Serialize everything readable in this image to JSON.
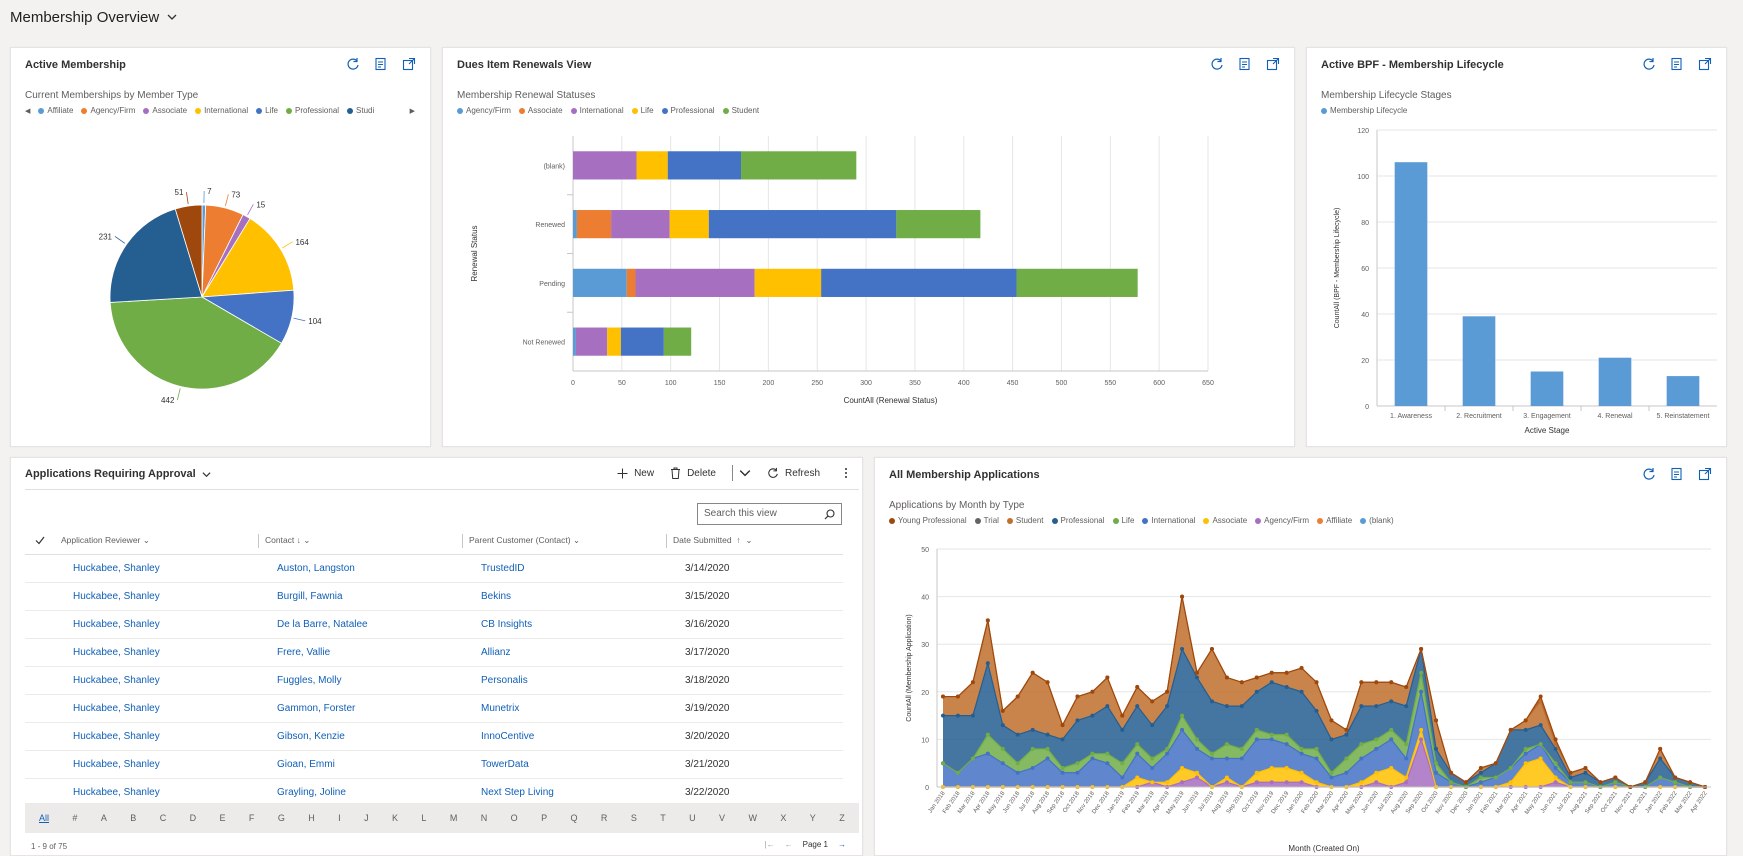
{
  "page": {
    "title": "Membership Overview"
  },
  "card_active_membership": {
    "title": "Active Membership",
    "chart_data": {
      "type": "pie",
      "title": "Current Memberships by Member Type",
      "legend": [
        {
          "name": "Affiliate",
          "color": "#5b9bd5"
        },
        {
          "name": "Agency/Firm",
          "color": "#ed7d31"
        },
        {
          "name": "Associate",
          "color": "#a66fbf"
        },
        {
          "name": "International",
          "color": "#ffc000"
        },
        {
          "name": "Life",
          "color": "#4472c4"
        },
        {
          "name": "Professional",
          "color": "#70ad47"
        },
        {
          "name": "Studi",
          "color": "#255e91"
        }
      ],
      "slices": [
        {
          "value": 7,
          "label": "7",
          "color": "#5b9bd5"
        },
        {
          "value": 73,
          "label": "73",
          "color": "#ed7d31"
        },
        {
          "value": 15,
          "label": "15",
          "color": "#a66fbf"
        },
        {
          "value": 164,
          "label": "164",
          "color": "#ffc000"
        },
        {
          "value": 104,
          "label": "104",
          "color": "#4472c4"
        },
        {
          "value": 442,
          "label": "442",
          "color": "#70ad47"
        },
        {
          "value": 231,
          "label": "231",
          "color": "#255e91"
        },
        {
          "value": 51,
          "label": "51",
          "color": "#9e480e"
        }
      ]
    }
  },
  "card_dues": {
    "title": "Dues Item Renewals View",
    "chart_data": {
      "type": "bar",
      "title": "Membership Renewal Statuses",
      "ylabel": "Renewal Status",
      "xlabel": "CountAll (Renewal Status)",
      "categories": [
        "(blank)",
        "Renewed",
        "Pending",
        "Not Renewed"
      ],
      "xticks": [
        "0",
        "50",
        "100",
        "150",
        "200",
        "250",
        "300",
        "350",
        "400",
        "450",
        "500",
        "550",
        "600",
        "650"
      ],
      "xlim": [
        0,
        650
      ],
      "series": [
        {
          "name": "Agency/Firm",
          "color": "#5b9bd5",
          "values": [
            0,
            4,
            55,
            3
          ]
        },
        {
          "name": "Associate",
          "color": "#ed7d31",
          "values": [
            0,
            35,
            9,
            0
          ]
        },
        {
          "name": "International",
          "color": "#a66fbf",
          "values": [
            65,
            60,
            122,
            32
          ]
        },
        {
          "name": "Life",
          "color": "#ffc000",
          "values": [
            32,
            40,
            68,
            14
          ]
        },
        {
          "name": "Professional",
          "color": "#4472c4",
          "values": [
            75,
            192,
            200,
            44
          ]
        },
        {
          "name": "Student",
          "color": "#70ad47",
          "values": [
            118,
            86,
            124,
            28
          ]
        }
      ]
    }
  },
  "card_bpf": {
    "title": "Active BPF - Membership Lifecycle",
    "chart_data": {
      "type": "bar",
      "title": "Membership Lifecycle Stages",
      "legend": [
        {
          "name": "Membership Lifecycle",
          "color": "#5b9bd5"
        }
      ],
      "categories": [
        "1. Awareness",
        "2. Recruitment",
        "3. Engagement",
        "4. Renewal",
        "5. Reinstatement"
      ],
      "values": [
        106,
        39,
        15,
        21,
        13
      ],
      "ylim": [
        0,
        120
      ],
      "yticks": [
        "0",
        "20",
        "40",
        "60",
        "80",
        "100",
        "120"
      ],
      "xlabel": "Active Stage",
      "ylabel": "CountAll (BPF - Membership Lifecycle)"
    }
  },
  "grid": {
    "title": "Applications Requiring Approval",
    "toolbar": {
      "new": "New",
      "delete": "Delete",
      "refresh": "Refresh"
    },
    "search_placeholder": "Search this view",
    "columns": [
      "Application Reviewer",
      "Contact",
      "Parent Customer (Contact)",
      "Date Submitted"
    ],
    "rows": [
      {
        "reviewer": "Huckabee, Shanley",
        "contact": "Auston, Langston",
        "customer": "TrustedID",
        "date": "3/14/2020"
      },
      {
        "reviewer": "Huckabee, Shanley",
        "contact": "Burgill, Fawnia",
        "customer": "Bekins",
        "date": "3/15/2020"
      },
      {
        "reviewer": "Huckabee, Shanley",
        "contact": "De la Barre, Natalee",
        "customer": "CB Insights",
        "date": "3/16/2020"
      },
      {
        "reviewer": "Huckabee, Shanley",
        "contact": "Frere, Vallie",
        "customer": "Allianz",
        "date": "3/17/2020"
      },
      {
        "reviewer": "Huckabee, Shanley",
        "contact": "Fuggles, Molly",
        "customer": "Personalis",
        "date": "3/18/2020"
      },
      {
        "reviewer": "Huckabee, Shanley",
        "contact": "Gammon, Forster",
        "customer": "Munetrix",
        "date": "3/19/2020"
      },
      {
        "reviewer": "Huckabee, Shanley",
        "contact": "Gibson, Kenzie",
        "customer": "InnoCentive",
        "date": "3/20/2020"
      },
      {
        "reviewer": "Huckabee, Shanley",
        "contact": "Gioan, Emmi",
        "customer": "TowerData",
        "date": "3/21/2020"
      },
      {
        "reviewer": "Huckabee, Shanley",
        "contact": "Grayling, Joline",
        "customer": "Next Step Living",
        "date": "3/22/2020"
      }
    ],
    "alpha": [
      "All",
      "#",
      "A",
      "B",
      "C",
      "D",
      "E",
      "F",
      "G",
      "H",
      "I",
      "J",
      "K",
      "L",
      "M",
      "N",
      "O",
      "P",
      "Q",
      "R",
      "S",
      "T",
      "U",
      "V",
      "W",
      "X",
      "Y",
      "Z"
    ],
    "count_text": "1 - 9 of 75",
    "page_text": "Page 1"
  },
  "card_apps": {
    "title": "All Membership Applications",
    "chart_data": {
      "type": "area",
      "title": "Applications by Month by Type",
      "xlabel": "Month (Created On)",
      "ylabel": "CountAll (Membership Application)",
      "ylim": [
        0,
        50
      ],
      "yticks": [
        "0",
        "10",
        "20",
        "30",
        "40",
        "50"
      ],
      "legend": [
        {
          "name": "Young Professional",
          "color": "#9e480e"
        },
        {
          "name": "Trial",
          "color": "#636363"
        },
        {
          "name": "Student",
          "color": "#c06f2c"
        },
        {
          "name": "Professional",
          "color": "#255e91"
        },
        {
          "name": "Life",
          "color": "#70ad47"
        },
        {
          "name": "International",
          "color": "#4472c4"
        },
        {
          "name": "Associate",
          "color": "#ffc000"
        },
        {
          "name": "Agency/Firm",
          "color": "#a66fbf"
        },
        {
          "name": "Affiliate",
          "color": "#ed7d31"
        },
        {
          "name": "(blank)",
          "color": "#5b9bd5"
        }
      ],
      "x": [
        "Jan 2018",
        "Feb 2018",
        "Mar 2018",
        "Apr 2018",
        "May 2018",
        "Jun 2018",
        "Jul 2018",
        "Aug 2018",
        "Sep 2018",
        "Oct 2018",
        "Nov 2018",
        "Dec 2018",
        "Jan 2019",
        "Feb 2019",
        "Mar 2019",
        "Apr 2019",
        "May 2019",
        "Jun 2019",
        "Jul 2019",
        "Aug 2019",
        "Sep 2019",
        "Oct 2019",
        "Nov 2019",
        "Dec 2019",
        "Jan 2020",
        "Feb 2020",
        "Mar 2020",
        "Apr 2020",
        "May 2020",
        "Jun 2020",
        "Jul 2020",
        "Aug 2020",
        "Sep 2020",
        "Oct 2020",
        "Nov 2020",
        "Dec 2020",
        "Jan 2021",
        "Feb 2021",
        "Mar 2021",
        "Apr 2021",
        "May 2021",
        "Jun 2021",
        "Jul 2021",
        "Aug 2021",
        "Sep 2021",
        "Oct 2021",
        "Nov 2021",
        "Dec 2021",
        "Jan 2022",
        "Feb 2022",
        "Mar 2022",
        "Apr 2022"
      ],
      "series": [
        {
          "name": "Agency/Firm",
          "color": "#a66fbf",
          "values": [
            0,
            0,
            0,
            0,
            0,
            0,
            0,
            0,
            0,
            0,
            0,
            0,
            0,
            0,
            1,
            0,
            1,
            2,
            0,
            1,
            0,
            1,
            1,
            1,
            1,
            0,
            0,
            0,
            0,
            1,
            0,
            1,
            10,
            0,
            0,
            0,
            0,
            0,
            0,
            0,
            0,
            1,
            0,
            0,
            0,
            0,
            0,
            0,
            0,
            0,
            0,
            0
          ]
        },
        {
          "name": "Associate",
          "color": "#ffc000",
          "values": [
            0,
            0,
            0,
            0,
            0,
            0,
            0,
            0,
            0,
            0,
            0,
            0,
            0,
            2,
            0,
            1,
            3,
            1,
            0,
            1,
            0,
            2,
            3,
            3,
            2,
            1,
            0,
            0,
            1,
            2,
            4,
            1,
            2,
            0,
            0,
            0,
            0,
            0,
            1,
            5,
            6,
            1,
            0,
            0,
            0,
            0,
            0,
            0,
            0,
            0,
            0,
            0
          ]
        },
        {
          "name": "International",
          "color": "#4472c4",
          "values": [
            5,
            3,
            6,
            7,
            5,
            3,
            4,
            6,
            3,
            3,
            6,
            5,
            2,
            5,
            3,
            6,
            8,
            5,
            6,
            4,
            6,
            7,
            6,
            5,
            4,
            5,
            2,
            3,
            5,
            5,
            6,
            4,
            8,
            3,
            1,
            0,
            1,
            2,
            3,
            2,
            3,
            2,
            1,
            1,
            0,
            1,
            0,
            0,
            2,
            1,
            0,
            0
          ]
        },
        {
          "name": "Life",
          "color": "#70ad47",
          "values": [
            0,
            0,
            0,
            4,
            3,
            2,
            4,
            2,
            1,
            2,
            1,
            2,
            3,
            2,
            2,
            1,
            3,
            2,
            1,
            3,
            2,
            2,
            1,
            2,
            1,
            2,
            1,
            3,
            3,
            2,
            2,
            3,
            4,
            2,
            0,
            0,
            1,
            0,
            0,
            1,
            0,
            1,
            0,
            0,
            0,
            0,
            0,
            0,
            0,
            0,
            0,
            0
          ]
        },
        {
          "name": "Professional",
          "color": "#255e91",
          "values": [
            10,
            12,
            9,
            15,
            5,
            6,
            4,
            3,
            6,
            9,
            8,
            10,
            7,
            8,
            7,
            9,
            14,
            13,
            11,
            8,
            9,
            8,
            11,
            10,
            12,
            8,
            7,
            5,
            8,
            7,
            6,
            8,
            5,
            3,
            2,
            1,
            1,
            3,
            8,
            4,
            4,
            3,
            1,
            2,
            1,
            1,
            0,
            1,
            4,
            1,
            1,
            0
          ]
        },
        {
          "name": "Student",
          "color": "#c06f2c",
          "values": [
            4,
            4,
            7,
            9,
            3,
            8,
            12,
            11,
            3,
            5,
            5,
            6,
            3,
            4,
            5,
            3,
            11,
            1,
            11,
            6,
            5,
            3,
            2,
            3,
            5,
            6,
            4,
            1,
            5,
            5,
            4,
            4,
            0,
            6,
            0,
            0,
            1,
            0,
            0,
            2,
            5,
            1,
            1,
            1,
            0,
            0,
            0,
            0,
            2,
            0,
            0,
            0
          ]
        },
        {
          "name": "Young Professional",
          "color": "#9e480e",
          "values": [
            0,
            0,
            0,
            0,
            0,
            0,
            0,
            0,
            0,
            0,
            0,
            0,
            0,
            0,
            0,
            0,
            0,
            0,
            0,
            0,
            0,
            0,
            0,
            0,
            0,
            0,
            0,
            0,
            0,
            0,
            0,
            0,
            0,
            0,
            0,
            0,
            0,
            0,
            0,
            0,
            1,
            1,
            0,
            0,
            0,
            0,
            0,
            0,
            0,
            0,
            0,
            0
          ]
        }
      ]
    }
  }
}
